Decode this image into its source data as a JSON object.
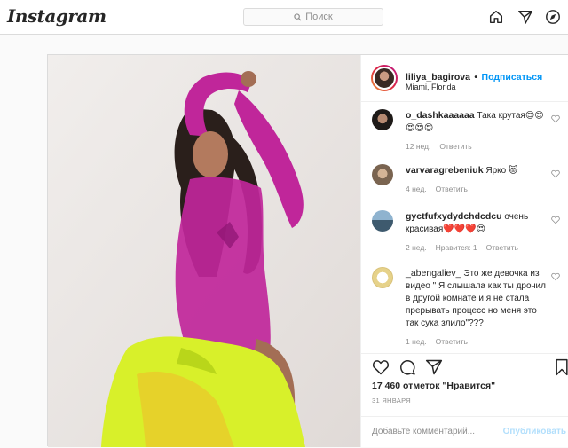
{
  "topbar": {
    "logo": "Instagram",
    "search_placeholder": "Поиск",
    "icons": [
      "home-icon",
      "send-icon",
      "explore-icon"
    ]
  },
  "post": {
    "header": {
      "username": "liliya_bagirova",
      "separator": "•",
      "follow_label": "Подписаться",
      "location": "Miami, Florida"
    },
    "comments": [
      {
        "username": "o_dashkaaaaaa",
        "text": "Така крутая😍😍😍😍😍",
        "time": "12 нед.",
        "reply": "Ответить",
        "likes": ""
      },
      {
        "username": "varvaragrebeniuk",
        "text": "Ярко 😻",
        "time": "4 нед.",
        "reply": "Ответить",
        "likes": ""
      },
      {
        "username": "gyctfufxydydchdcdcu",
        "text": "очень красивая❤️❤️❤️😍",
        "time": "2 нед.",
        "reply": "Ответить",
        "likes": "Нравится: 1"
      },
      {
        "username": "_abengaliev_",
        "text": "Это же девочка из видео \" Я слышала как ты дрочил в другой комнате и я не стала прерывать процесс но меня это так сука злило\"???",
        "time": "1 нед.",
        "reply": "Ответить",
        "likes": ""
      }
    ],
    "likes_text": "17 460 отметок \"Нравится\"",
    "date": "31 ЯНВАРЯ",
    "add_comment_placeholder": "Добавьте комментарий...",
    "publish_label": "Опубликовать",
    "colors": {
      "accent": "#0095f6",
      "bodysuit": "#c0269a",
      "skirt": "#d8f02a"
    }
  }
}
